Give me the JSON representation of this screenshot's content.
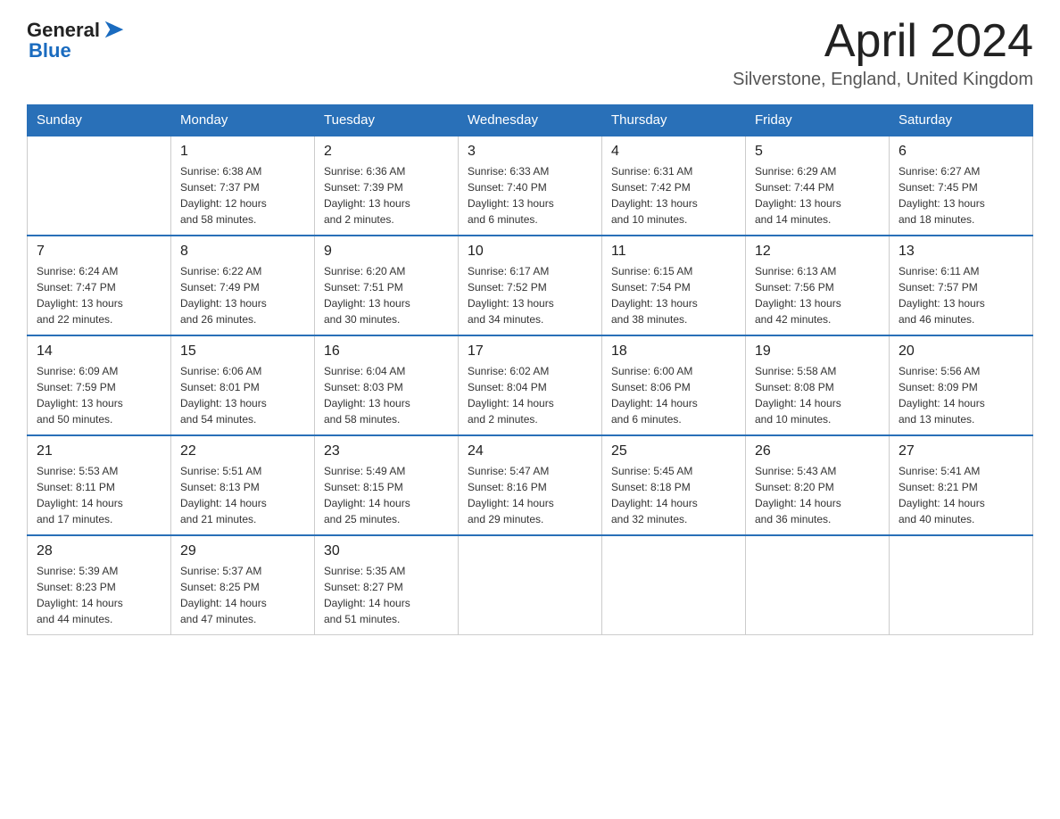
{
  "header": {
    "logo_general": "General",
    "logo_blue": "Blue",
    "month_title": "April 2024",
    "location": "Silverstone, England, United Kingdom"
  },
  "days_of_week": [
    "Sunday",
    "Monday",
    "Tuesday",
    "Wednesday",
    "Thursday",
    "Friday",
    "Saturday"
  ],
  "weeks": [
    [
      {
        "day": "",
        "info": ""
      },
      {
        "day": "1",
        "info": "Sunrise: 6:38 AM\nSunset: 7:37 PM\nDaylight: 12 hours\nand 58 minutes."
      },
      {
        "day": "2",
        "info": "Sunrise: 6:36 AM\nSunset: 7:39 PM\nDaylight: 13 hours\nand 2 minutes."
      },
      {
        "day": "3",
        "info": "Sunrise: 6:33 AM\nSunset: 7:40 PM\nDaylight: 13 hours\nand 6 minutes."
      },
      {
        "day": "4",
        "info": "Sunrise: 6:31 AM\nSunset: 7:42 PM\nDaylight: 13 hours\nand 10 minutes."
      },
      {
        "day": "5",
        "info": "Sunrise: 6:29 AM\nSunset: 7:44 PM\nDaylight: 13 hours\nand 14 minutes."
      },
      {
        "day": "6",
        "info": "Sunrise: 6:27 AM\nSunset: 7:45 PM\nDaylight: 13 hours\nand 18 minutes."
      }
    ],
    [
      {
        "day": "7",
        "info": "Sunrise: 6:24 AM\nSunset: 7:47 PM\nDaylight: 13 hours\nand 22 minutes."
      },
      {
        "day": "8",
        "info": "Sunrise: 6:22 AM\nSunset: 7:49 PM\nDaylight: 13 hours\nand 26 minutes."
      },
      {
        "day": "9",
        "info": "Sunrise: 6:20 AM\nSunset: 7:51 PM\nDaylight: 13 hours\nand 30 minutes."
      },
      {
        "day": "10",
        "info": "Sunrise: 6:17 AM\nSunset: 7:52 PM\nDaylight: 13 hours\nand 34 minutes."
      },
      {
        "day": "11",
        "info": "Sunrise: 6:15 AM\nSunset: 7:54 PM\nDaylight: 13 hours\nand 38 minutes."
      },
      {
        "day": "12",
        "info": "Sunrise: 6:13 AM\nSunset: 7:56 PM\nDaylight: 13 hours\nand 42 minutes."
      },
      {
        "day": "13",
        "info": "Sunrise: 6:11 AM\nSunset: 7:57 PM\nDaylight: 13 hours\nand 46 minutes."
      }
    ],
    [
      {
        "day": "14",
        "info": "Sunrise: 6:09 AM\nSunset: 7:59 PM\nDaylight: 13 hours\nand 50 minutes."
      },
      {
        "day": "15",
        "info": "Sunrise: 6:06 AM\nSunset: 8:01 PM\nDaylight: 13 hours\nand 54 minutes."
      },
      {
        "day": "16",
        "info": "Sunrise: 6:04 AM\nSunset: 8:03 PM\nDaylight: 13 hours\nand 58 minutes."
      },
      {
        "day": "17",
        "info": "Sunrise: 6:02 AM\nSunset: 8:04 PM\nDaylight: 14 hours\nand 2 minutes."
      },
      {
        "day": "18",
        "info": "Sunrise: 6:00 AM\nSunset: 8:06 PM\nDaylight: 14 hours\nand 6 minutes."
      },
      {
        "day": "19",
        "info": "Sunrise: 5:58 AM\nSunset: 8:08 PM\nDaylight: 14 hours\nand 10 minutes."
      },
      {
        "day": "20",
        "info": "Sunrise: 5:56 AM\nSunset: 8:09 PM\nDaylight: 14 hours\nand 13 minutes."
      }
    ],
    [
      {
        "day": "21",
        "info": "Sunrise: 5:53 AM\nSunset: 8:11 PM\nDaylight: 14 hours\nand 17 minutes."
      },
      {
        "day": "22",
        "info": "Sunrise: 5:51 AM\nSunset: 8:13 PM\nDaylight: 14 hours\nand 21 minutes."
      },
      {
        "day": "23",
        "info": "Sunrise: 5:49 AM\nSunset: 8:15 PM\nDaylight: 14 hours\nand 25 minutes."
      },
      {
        "day": "24",
        "info": "Sunrise: 5:47 AM\nSunset: 8:16 PM\nDaylight: 14 hours\nand 29 minutes."
      },
      {
        "day": "25",
        "info": "Sunrise: 5:45 AM\nSunset: 8:18 PM\nDaylight: 14 hours\nand 32 minutes."
      },
      {
        "day": "26",
        "info": "Sunrise: 5:43 AM\nSunset: 8:20 PM\nDaylight: 14 hours\nand 36 minutes."
      },
      {
        "day": "27",
        "info": "Sunrise: 5:41 AM\nSunset: 8:21 PM\nDaylight: 14 hours\nand 40 minutes."
      }
    ],
    [
      {
        "day": "28",
        "info": "Sunrise: 5:39 AM\nSunset: 8:23 PM\nDaylight: 14 hours\nand 44 minutes."
      },
      {
        "day": "29",
        "info": "Sunrise: 5:37 AM\nSunset: 8:25 PM\nDaylight: 14 hours\nand 47 minutes."
      },
      {
        "day": "30",
        "info": "Sunrise: 5:35 AM\nSunset: 8:27 PM\nDaylight: 14 hours\nand 51 minutes."
      },
      {
        "day": "",
        "info": ""
      },
      {
        "day": "",
        "info": ""
      },
      {
        "day": "",
        "info": ""
      },
      {
        "day": "",
        "info": ""
      }
    ]
  ]
}
